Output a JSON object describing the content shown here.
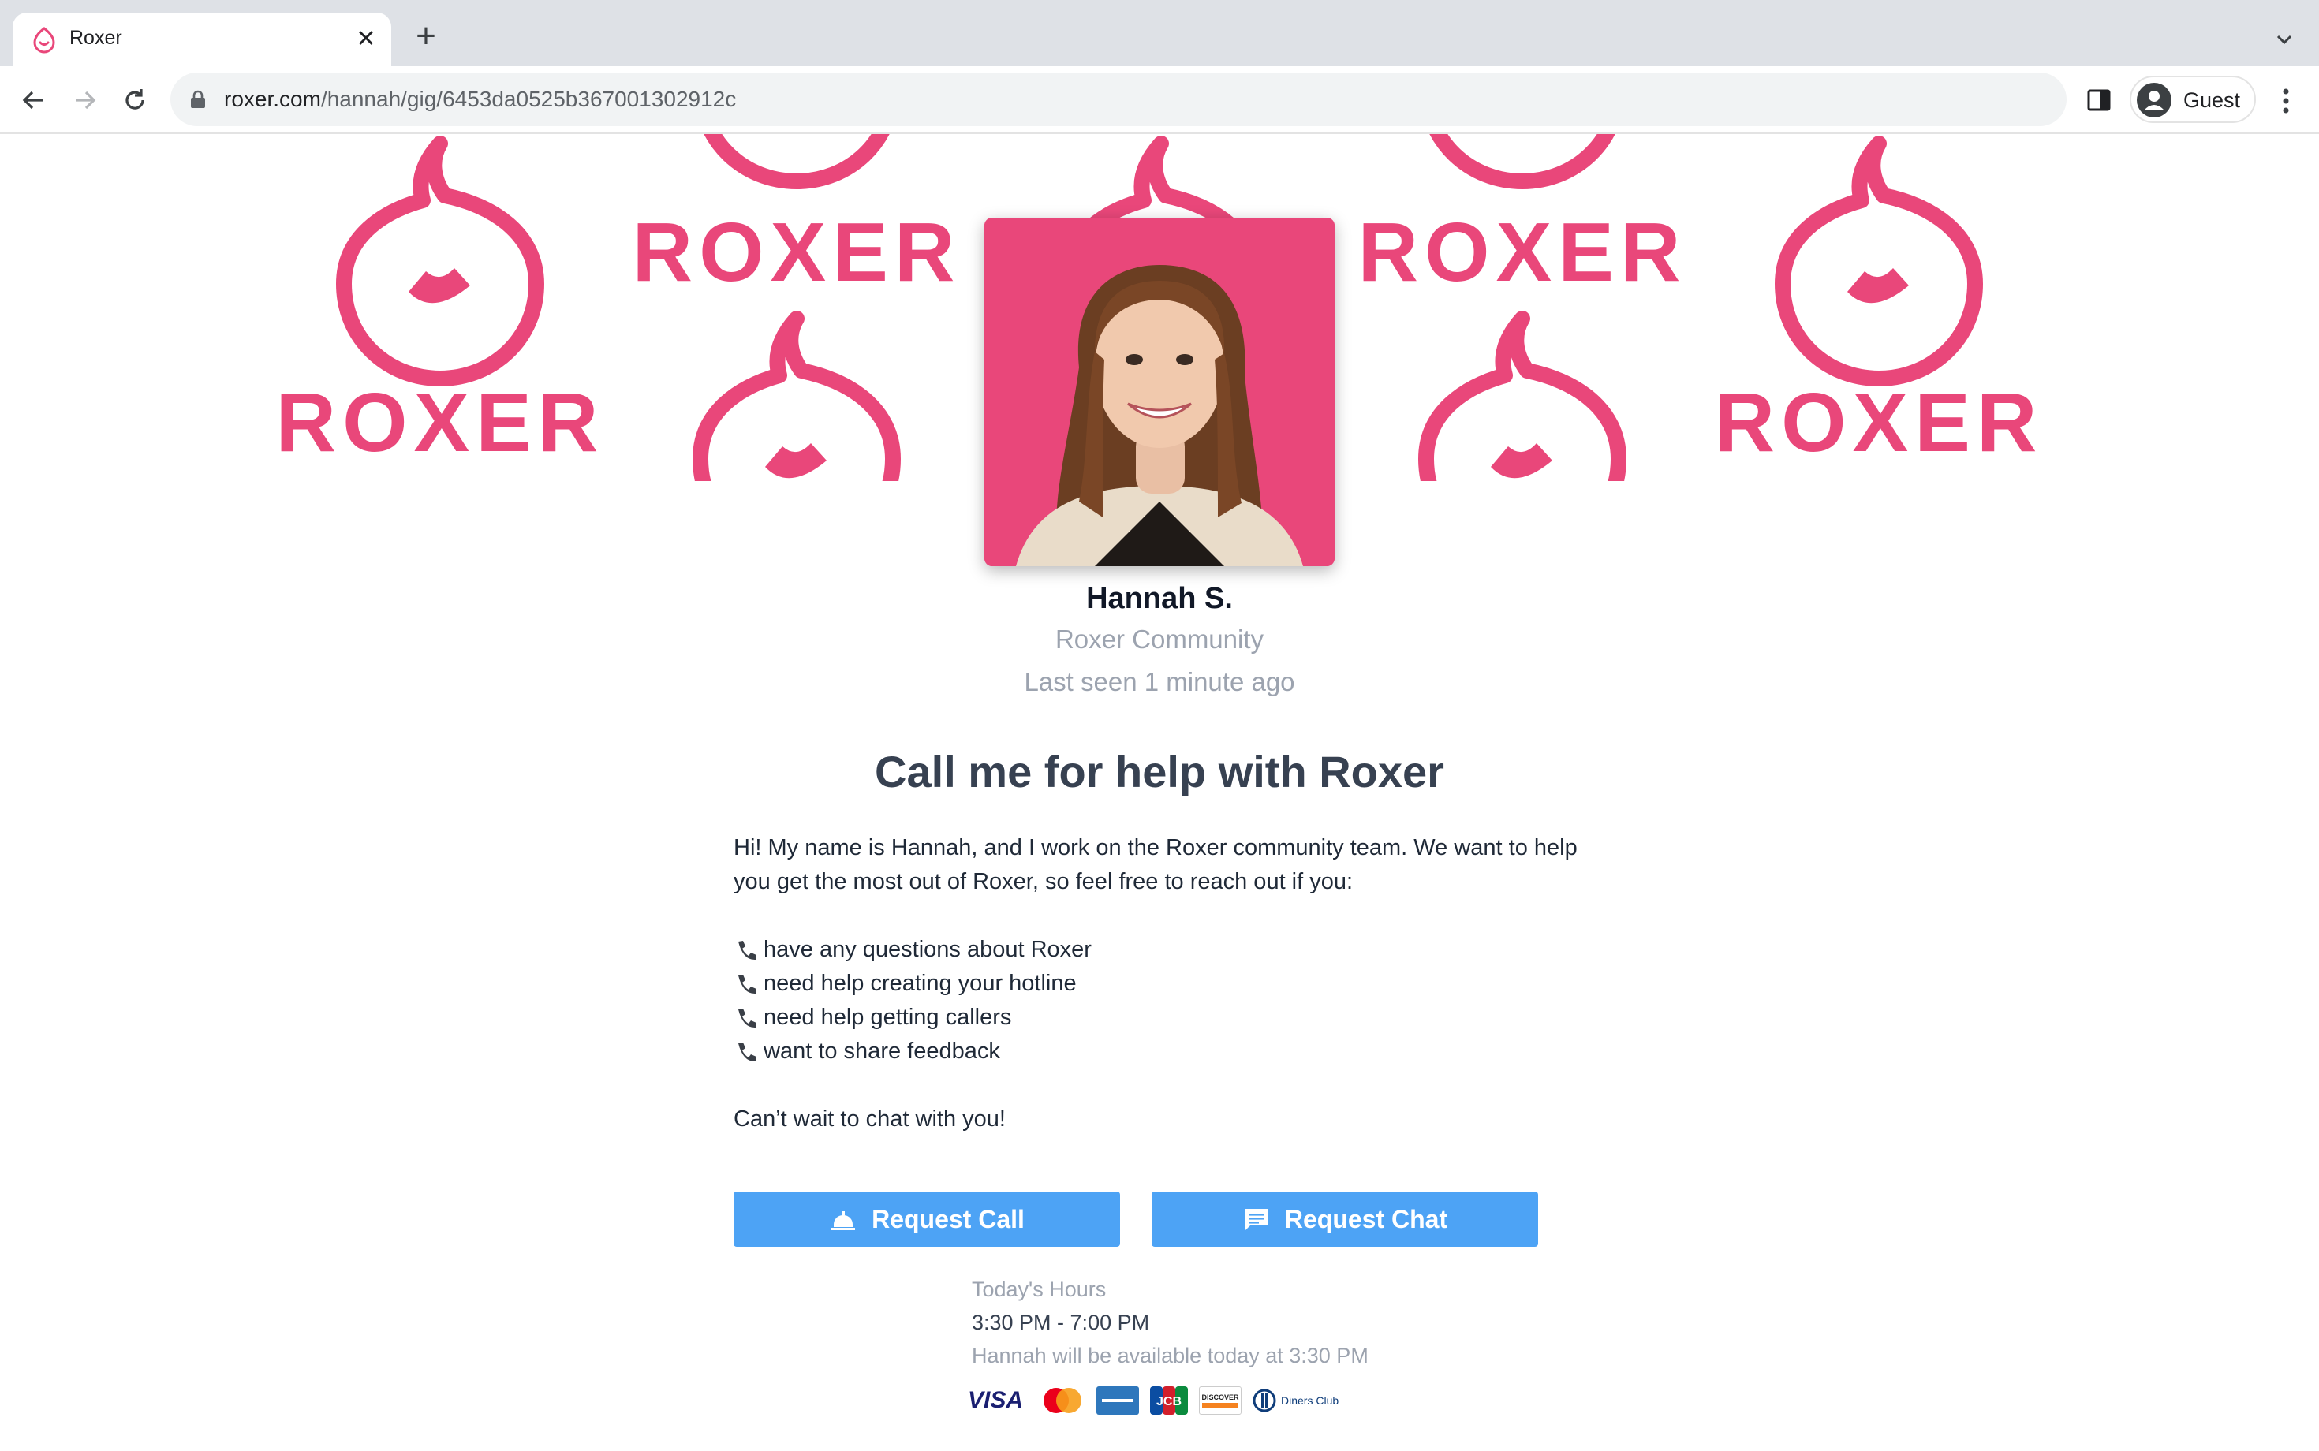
{
  "browser": {
    "tab_title": "Roxer",
    "url_host": "roxer.com",
    "url_path": "/hannah/gig/6453da0525b367001302912c",
    "profile_label": "Guest"
  },
  "banner": {
    "wordmark": "ROXER",
    "brand_color": "#e9477a"
  },
  "profile": {
    "name": "Hannah S.",
    "community": "Roxer Community",
    "last_seen": "Last seen 1 minute ago"
  },
  "gig": {
    "title": "Call me for help with Roxer",
    "intro": "Hi! My name is Hannah, and I work on the Roxer community team. We want to help you get the most out of Roxer, so feel free to reach out if you:",
    "bullets": [
      "have any questions about Roxer",
      "need help creating your hotline",
      "need help getting callers",
      "want to share feedback"
    ],
    "closing": "Can’t wait to chat with you!"
  },
  "actions": {
    "request_call": "Request Call",
    "request_chat": "Request Chat",
    "button_color": "#4da3f5"
  },
  "hours": {
    "label": "Today's Hours",
    "value": "3:30 PM - 7:00 PM",
    "availability": "Hannah will be available today at 3:30 PM"
  },
  "payment_cards": [
    "VISA",
    "MasterCard",
    "American Express",
    "JCB",
    "DISCOVER",
    "Diners Club"
  ]
}
